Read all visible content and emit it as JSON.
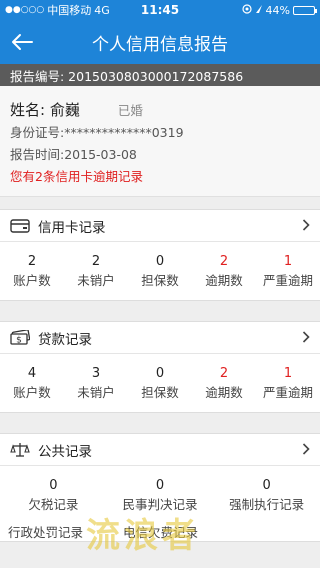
{
  "status_bar": {
    "signal": "●●○○○",
    "carrier": "中国移动",
    "network": "4G",
    "time": "11:45",
    "battery_pct": "44%",
    "battery_level": 0.44
  },
  "nav": {
    "title": "个人信用信息报告"
  },
  "report": {
    "number_label": "报告编号: 2015030803000172087586"
  },
  "person": {
    "name": "姓名: 俞巍",
    "marital": "已婚",
    "id_number": "身份证号:**************0319",
    "report_time": "报告时间:2015-03-08",
    "warning": "您有2条信用卡逾期记录"
  },
  "credit_card": {
    "title": "信用卡记录",
    "stats": [
      {
        "value": "2",
        "label": "账户数",
        "alert": false
      },
      {
        "value": "2",
        "label": "未销户",
        "alert": false
      },
      {
        "value": "0",
        "label": "担保数",
        "alert": false
      },
      {
        "value": "2",
        "label": "逾期数",
        "alert": true
      },
      {
        "value": "1",
        "label": "严重逾期",
        "alert": true
      }
    ]
  },
  "loan": {
    "title": "贷款记录",
    "stats": [
      {
        "value": "4",
        "label": "账户数",
        "alert": false
      },
      {
        "value": "3",
        "label": "未销户",
        "alert": false
      },
      {
        "value": "0",
        "label": "担保数",
        "alert": false
      },
      {
        "value": "2",
        "label": "逾期数",
        "alert": true
      },
      {
        "value": "1",
        "label": "严重逾期",
        "alert": true
      }
    ]
  },
  "public": {
    "title": "公共记录",
    "stats": [
      {
        "value": "0",
        "label": "欠税记录"
      },
      {
        "value": "0",
        "label": "民事判决记录"
      },
      {
        "value": "0",
        "label": "强制执行记录"
      }
    ],
    "next_row": [
      "行政处罚记录",
      "电信欠费记录"
    ]
  },
  "watermark": "流浪者",
  "colors": {
    "brand": "#1e84d8",
    "alert": "#e02020",
    "report_bar": "#5b5b5b"
  }
}
